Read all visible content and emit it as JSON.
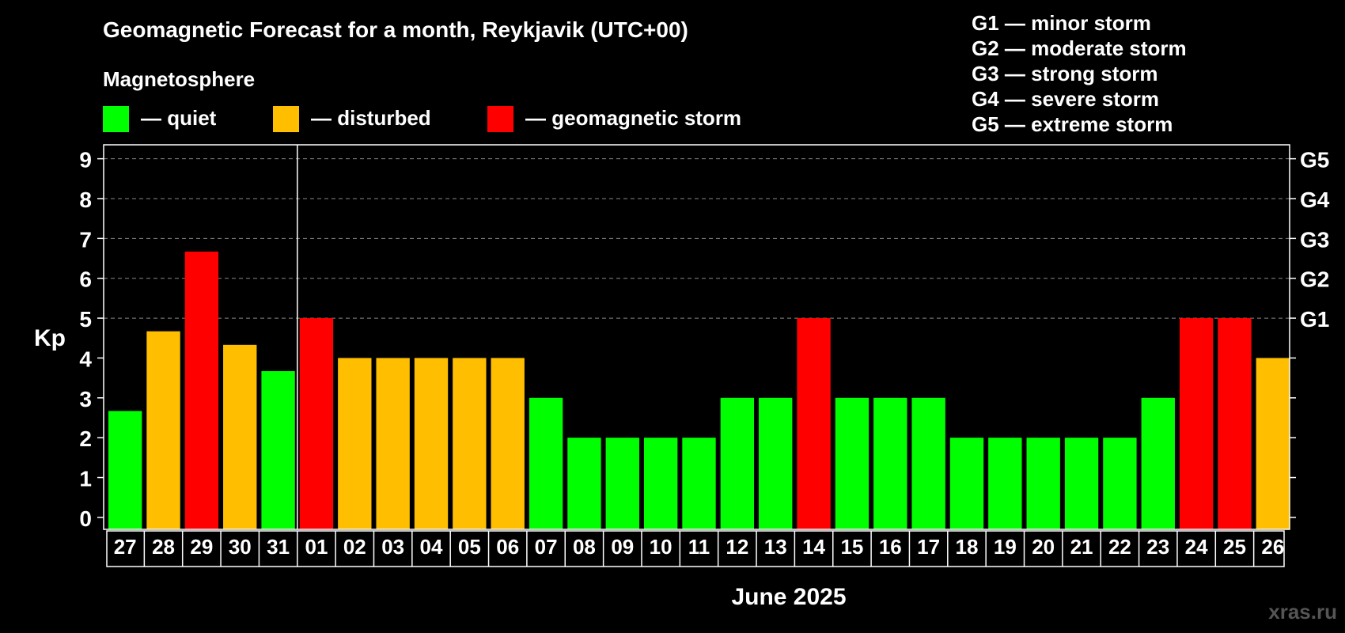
{
  "chart_data": {
    "type": "bar",
    "title": "Geomagnetic Forecast for a month, Reykjavik (UTC+00)",
    "section_label": "Magnetosphere",
    "legend": [
      {
        "label": "— quiet",
        "color": "#00ff00"
      },
      {
        "label": "— disturbed",
        "color": "#ffbf00"
      },
      {
        "label": "— geomagnetic storm",
        "color": "#ff0000"
      }
    ],
    "storm_scale": [
      "G1 — minor storm",
      "G2 — moderate storm",
      "G3 — strong storm",
      "G4 — severe storm",
      "G5 — extreme storm"
    ],
    "ylabel": "Kp",
    "xlabel": "June 2025",
    "ylim": [
      -0.3,
      9.35
    ],
    "yticks": [
      0,
      1,
      2,
      3,
      4,
      5,
      6,
      7,
      8,
      9
    ],
    "right_ticks": [
      {
        "value": 5,
        "label": "G1"
      },
      {
        "value": 6,
        "label": "G2"
      },
      {
        "value": 7,
        "label": "G3"
      },
      {
        "value": 8,
        "label": "G4"
      },
      {
        "value": 9,
        "label": "G5"
      }
    ],
    "grid": "dashed horizontal at G levels",
    "month_divider_after_index": 4,
    "categories": [
      "27",
      "28",
      "29",
      "30",
      "31",
      "01",
      "02",
      "03",
      "04",
      "05",
      "06",
      "07",
      "08",
      "09",
      "10",
      "11",
      "12",
      "13",
      "14",
      "15",
      "16",
      "17",
      "18",
      "19",
      "20",
      "21",
      "22",
      "23",
      "24",
      "25",
      "26"
    ],
    "values": [
      2.67,
      4.67,
      6.67,
      4.33,
      3.67,
      5,
      4,
      4,
      4,
      4,
      4,
      3,
      2,
      2,
      2,
      2,
      3,
      3,
      5,
      3,
      3,
      3,
      2,
      2,
      2,
      2,
      2,
      3,
      5,
      5,
      4
    ],
    "status": [
      "quiet",
      "disturbed",
      "storm",
      "disturbed",
      "quiet",
      "storm",
      "disturbed",
      "disturbed",
      "disturbed",
      "disturbed",
      "disturbed",
      "quiet",
      "quiet",
      "quiet",
      "quiet",
      "quiet",
      "quiet",
      "quiet",
      "storm",
      "quiet",
      "quiet",
      "quiet",
      "quiet",
      "quiet",
      "quiet",
      "quiet",
      "quiet",
      "quiet",
      "storm",
      "storm",
      "disturbed"
    ],
    "status_colors": {
      "quiet": "#00ff00",
      "disturbed": "#ffbf00",
      "storm": "#ff0000"
    }
  },
  "watermark": "xras.ru"
}
